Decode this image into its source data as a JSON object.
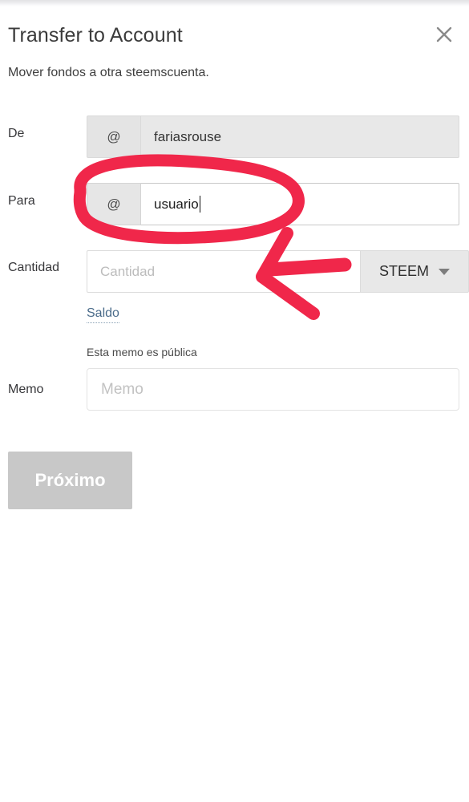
{
  "dialog": {
    "title": "Transfer to Account",
    "subtitle": "Mover fondos a otra steemscuenta.",
    "close_icon": "close-icon"
  },
  "form": {
    "from": {
      "label": "De",
      "prefix": "@",
      "value": "fariasrouse"
    },
    "to": {
      "label": "Para",
      "prefix": "@",
      "value": "usuario"
    },
    "amount": {
      "label": "Cantidad",
      "placeholder": "Cantidad",
      "value": "",
      "currency": "STEEM",
      "currency_caret_icon": "chevron-down-icon"
    },
    "balance_link": "Saldo",
    "memo": {
      "label": "Memo",
      "hint": "Esta memo es pública",
      "placeholder": "Memo",
      "value": ""
    },
    "submit_label": "Próximo"
  },
  "annotations": {
    "color": "#f0274a",
    "marks": [
      {
        "name": "ellipse-highlight-to-field",
        "shape": "ellipse"
      },
      {
        "name": "arrow-pointing-to-amount-field",
        "shape": "arrow"
      }
    ]
  },
  "colors": {
    "annotation_red": "#f0274a",
    "link_blue": "#4a6b8a",
    "disabled_button_grey": "#c8c8c8",
    "field_grey": "#e6e6e6"
  }
}
